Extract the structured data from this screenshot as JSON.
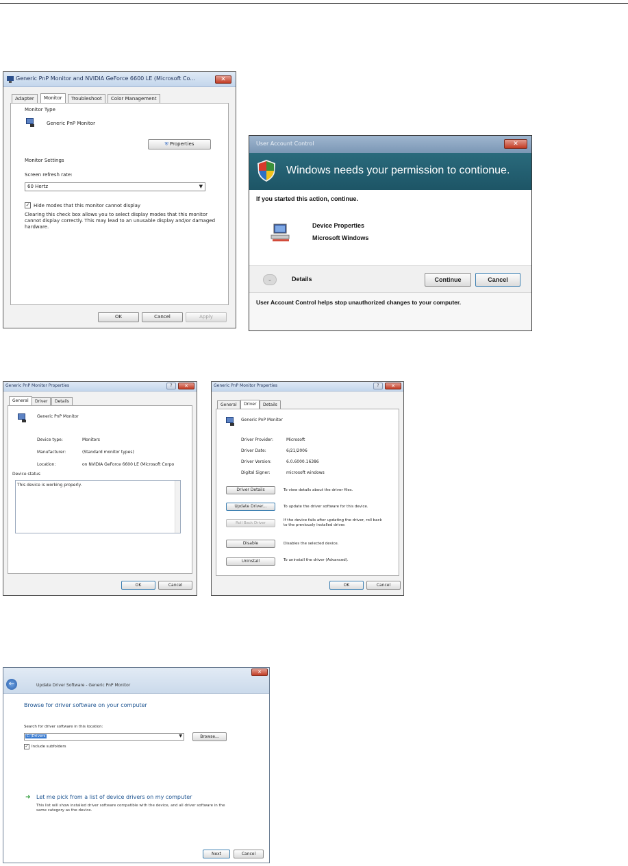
{
  "dialog1": {
    "title": "Generic PnP Monitor and NVIDIA GeForce 6600 LE (Microsoft Co...",
    "tabs": [
      "Adapter",
      "Monitor",
      "Troubleshoot",
      "Color Management"
    ],
    "monitor_type_label": "Monitor Type",
    "monitor_name": "Generic PnP Monitor",
    "properties_button": "Properties",
    "monitor_settings_label": "Monitor Settings",
    "refresh_rate_label": "Screen refresh rate:",
    "refresh_rate_value": "60 Hertz",
    "hide_modes_label": "Hide modes that this monitor cannot display",
    "hide_modes_description": "Clearing this check box allows you to select display modes that this monitor cannot display correctly. This may lead to an unusable display and/or damaged hardware.",
    "ok": "OK",
    "cancel": "Cancel",
    "apply": "Apply"
  },
  "uac": {
    "title": "User Account Control",
    "banner": "Windows needs your permission to contionue.",
    "prompt": "If you started this action, continue.",
    "program_name": "Device Properties",
    "publisher": "Microsoft Windows",
    "details": "Details",
    "continue": "Continue",
    "cancel": "Cancel",
    "footer": "User Account Control helps stop unauthorized changes to your computer."
  },
  "dialog_general": {
    "title": "Generic PnP Monitor Properties",
    "tabs": [
      "General",
      "Driver",
      "Details"
    ],
    "device_name": "Generic PnP Monitor",
    "device_type_label": "Device type:",
    "device_type_value": "Monitors",
    "manufacturer_label": "Manufacturer:",
    "manufacturer_value": "(Standard monitor types)",
    "location_label": "Location:",
    "location_value": "on NVIDIA GeForce 6600 LE (Microsoft Corpo",
    "status_label": "Device status",
    "status_text": "This device is working properly.",
    "ok": "OK",
    "cancel": "Cancel"
  },
  "dialog_driver": {
    "title": "Generic PnP Monitor Properties",
    "tabs": [
      "General",
      "Driver",
      "Details"
    ],
    "device_name": "Generic PnP Monitor",
    "rows": [
      {
        "label": "Driver Provider:",
        "value": "Microsoft"
      },
      {
        "label": "Driver Date:",
        "value": "6/21/2006"
      },
      {
        "label": "Driver Version:",
        "value": "6.0.6000.16386"
      },
      {
        "label": "Digital Signer:",
        "value": "microsoft windows"
      }
    ],
    "actions": [
      {
        "button": "Driver Details",
        "desc": "To view details about the driver files."
      },
      {
        "button": "Update Driver...",
        "desc": "To update the driver software for this device."
      },
      {
        "button": "Roll Back Driver",
        "desc": "If the device fails after updating the driver, roll back to the previously installed driver."
      },
      {
        "button": "Disable",
        "desc": "Disables the selected device."
      },
      {
        "button": "Uninstall",
        "desc": "To uninstall the driver (Advanced)."
      }
    ],
    "ok": "OK",
    "cancel": "Cancel"
  },
  "wizard": {
    "title": "Update Driver Software - Generic PnP Monitor",
    "heading": "Browse for driver software on your computer",
    "search_label": "Search for driver software in this location:",
    "path_value": "C:\\Drivers",
    "browse": "Browse...",
    "include_subfolders": "Include subfolders",
    "pick_link": "Let me pick from a list of device drivers on my computer",
    "pick_desc": "This list will show installed driver software compatible with the device, and all driver software in the same category as the device.",
    "next": "Next",
    "cancel": "Cancel"
  }
}
